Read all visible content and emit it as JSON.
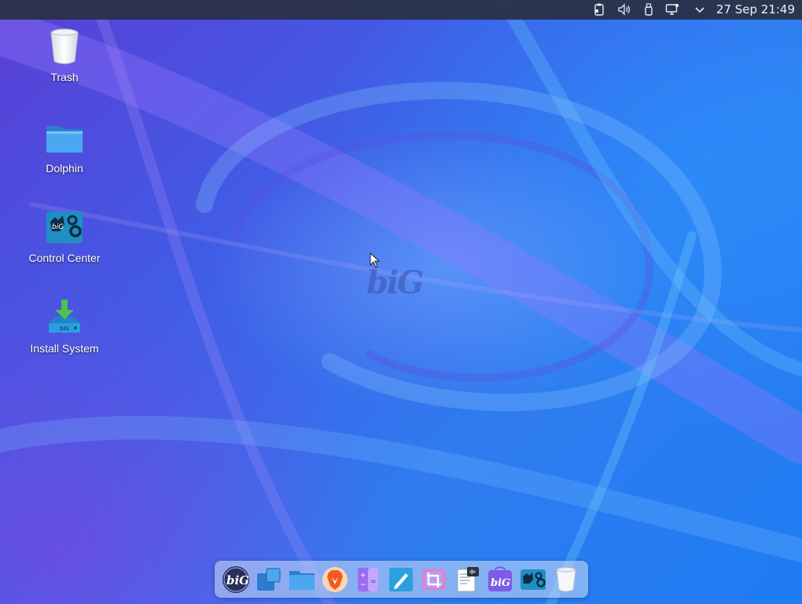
{
  "top_bar": {
    "clock": "27 Sep 21:49",
    "tray": [
      {
        "icon": "clipboard-icon"
      },
      {
        "icon": "volume-icon"
      },
      {
        "icon": "usb-device-icon"
      },
      {
        "icon": "network-icon"
      },
      {
        "icon": "chevron-down-icon"
      }
    ]
  },
  "desktop": {
    "wallpaper_logo": "biG",
    "icons": [
      {
        "label": "Trash",
        "icon": "trash-icon"
      },
      {
        "label": "Dolphin",
        "icon": "folder-icon"
      },
      {
        "label": "Control Center",
        "icon": "control-center-icon"
      },
      {
        "label": "Install System",
        "icon": "install-system-icon"
      }
    ]
  },
  "dock": {
    "items": [
      {
        "icon": "biglinux-menu-icon"
      },
      {
        "icon": "windows-overview-icon"
      },
      {
        "icon": "file-manager-icon"
      },
      {
        "icon": "brave-browser-icon"
      },
      {
        "icon": "calculator-icon"
      },
      {
        "icon": "text-editor-icon"
      },
      {
        "icon": "screenshot-crop-icon"
      },
      {
        "icon": "document-reader-icon"
      },
      {
        "icon": "biglinux-store-icon"
      },
      {
        "icon": "control-center-icon"
      },
      {
        "icon": "trash-icon"
      }
    ]
  },
  "colors": {
    "top_bar": "#283042",
    "desktop_base": "#2f7cf0",
    "accent_purple": "#5a3fd6",
    "folder_blue": "#3d9be9",
    "install_green": "#4cc34f"
  }
}
